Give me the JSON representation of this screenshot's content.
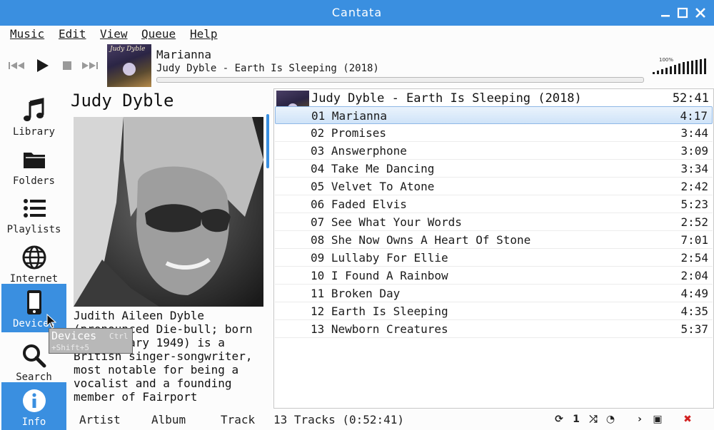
{
  "window": {
    "title": "Cantata"
  },
  "menu": [
    {
      "label": "Music"
    },
    {
      "label": "Edit"
    },
    {
      "label": "View"
    },
    {
      "label": "Queue"
    },
    {
      "label": "Help"
    }
  ],
  "now_playing": {
    "title": "Marianna",
    "subtitle": "Judy Dyble - Earth Is Sleeping (2018)",
    "cover_text": "Judy Dyble",
    "progress": 0.0,
    "volume_label": "100%",
    "volume": 1.0
  },
  "sidebar": {
    "items": [
      {
        "label": "Library",
        "icon": "music-note-icon"
      },
      {
        "label": "Folders",
        "icon": "folder-icon"
      },
      {
        "label": "Playlists",
        "icon": "list-icon"
      },
      {
        "label": "Internet",
        "icon": "globe-icon"
      },
      {
        "label": "Devices",
        "icon": "phone-icon",
        "selected": true
      },
      {
        "label": "Search",
        "icon": "search-icon"
      },
      {
        "label": "Info",
        "icon": "info-icon",
        "selected": true
      }
    ]
  },
  "tooltip": {
    "title": "Devices",
    "shortcut_a": "Ctrl",
    "shortcut_b": "+Shift+5"
  },
  "info": {
    "artist": "Judy Dyble",
    "bio_lines": [
      "Judith Aileen Dyble",
      "(pronounced Die-bull; born",
      "13 February 1949) is a",
      "British singer-songwriter,",
      "most notable for being a",
      "vocalist and a founding",
      "member of Fairport"
    ]
  },
  "playlist": {
    "album": "Judy Dyble - Earth Is Sleeping (2018)",
    "total": "52:41",
    "tracks": [
      {
        "name": "01 Marianna",
        "duration": "4:17",
        "selected": true
      },
      {
        "name": "02 Promises",
        "duration": "3:44"
      },
      {
        "name": "03 Answerphone",
        "duration": "3:09"
      },
      {
        "name": "04 Take Me Dancing",
        "duration": "3:34"
      },
      {
        "name": "05 Velvet To Atone",
        "duration": "2:42"
      },
      {
        "name": "06 Faded Elvis",
        "duration": "5:23"
      },
      {
        "name": "07 See What Your Words",
        "duration": "2:52"
      },
      {
        "name": "08 She Now Owns A Heart Of Stone",
        "duration": "7:01"
      },
      {
        "name": "09 Lullaby For Ellie",
        "duration": "2:54"
      },
      {
        "name": "10 I Found A Rainbow",
        "duration": "2:04"
      },
      {
        "name": "11 Broken Day",
        "duration": "4:49"
      },
      {
        "name": "12 Earth Is Sleeping",
        "duration": "4:35"
      },
      {
        "name": "13 Newborn Creatures",
        "duration": "5:37"
      }
    ]
  },
  "status": {
    "tabs": [
      {
        "label": "Artist"
      },
      {
        "label": "Album"
      },
      {
        "label": "Track"
      }
    ],
    "summary": "13 Tracks (0:52:41)",
    "controls": [
      {
        "name": "repeat-icon",
        "glyph": "⟳"
      },
      {
        "name": "single-icon",
        "glyph": "1"
      },
      {
        "name": "shuffle-icon",
        "glyph": "⤮"
      },
      {
        "name": "consume-icon",
        "glyph": "◔"
      },
      {
        "name": "next-page-icon",
        "glyph": "›"
      },
      {
        "name": "save-icon",
        "glyph": "▣"
      },
      {
        "name": "clear-icon",
        "glyph": "✖"
      }
    ],
    "clear_color": "#d22020"
  },
  "colors": {
    "accent": "#3a8fe0"
  }
}
